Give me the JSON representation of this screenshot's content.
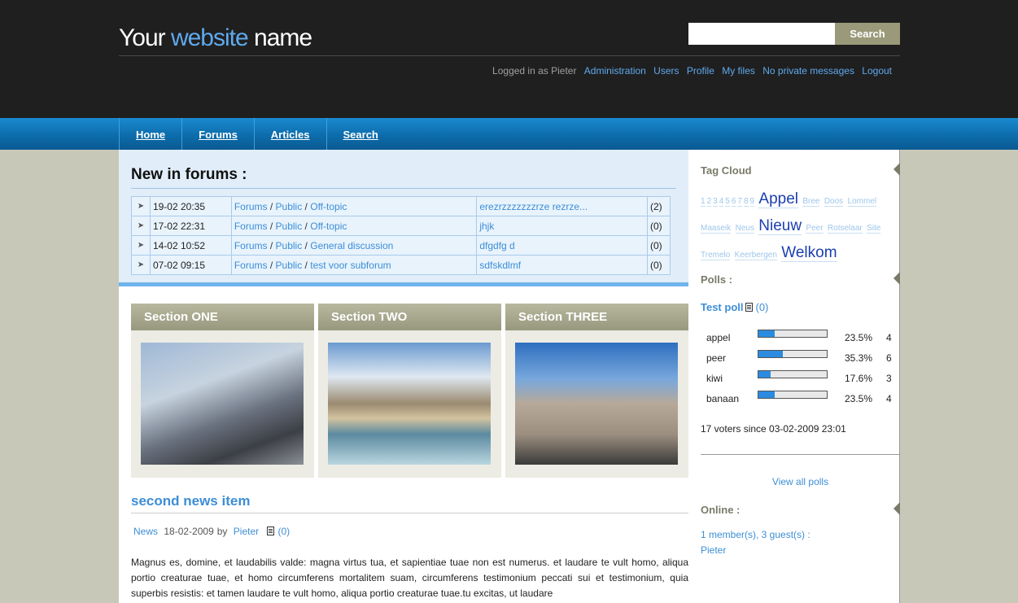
{
  "header": {
    "title_part1": "Your ",
    "title_accent": "website",
    "title_part2": " name",
    "search_value": "",
    "search_button": "Search"
  },
  "userbar": {
    "logged_in_text": "Logged in as Pieter",
    "links": [
      "Administration",
      "Users",
      "Profile",
      "My files",
      "No private messages",
      "Logout"
    ]
  },
  "nav": [
    "Home",
    "Forums",
    "Articles",
    "Search"
  ],
  "forums": {
    "title": "New in forums :",
    "separator": "/",
    "rows": [
      {
        "date": "19-02 20:35",
        "path": [
          "Forums",
          "Public",
          "Off-topic"
        ],
        "topic": "erezrzzzzzzzrze rezrze...",
        "count": "(2)"
      },
      {
        "date": "17-02 22:31",
        "path": [
          "Forums",
          "Public",
          "Off-topic"
        ],
        "topic": "jhjk",
        "count": "(0)"
      },
      {
        "date": "14-02 10:52",
        "path": [
          "Forums",
          "Public",
          "General discussion"
        ],
        "topic": "dfgdfg d",
        "count": "(0)"
      },
      {
        "date": "07-02 09:15",
        "path": [
          "Forums",
          "Public",
          "test voor subforum"
        ],
        "topic": "sdfskdlmf",
        "count": "(0)"
      }
    ]
  },
  "sections": [
    {
      "title": "Section ONE"
    },
    {
      "title": "Section TWO"
    },
    {
      "title": "Section THREE"
    }
  ],
  "news": {
    "title": "second news item",
    "category": "News",
    "date": "18-02-2009",
    "by": "by",
    "author": "Pieter",
    "comments": "(0)",
    "body": "Magnus es, domine, et laudabilis valde: magna virtus tua, et sapientiae tuae non est numerus. et laudare te vult homo, aliqua portio creaturae tuae, et homo circumferens mortalitem suam, circumferens testimonium peccati sui et testimonium, quia superbis resistis: et tamen laudare te vult homo, aliqua portio creaturae tuae.tu excitas, ut laudare"
  },
  "sidebar": {
    "tagcloud_title": "Tag Cloud",
    "tags_line1_small": [
      "1",
      "2",
      "3",
      "4",
      "5",
      "6",
      "7",
      "8",
      "9"
    ],
    "tags": {
      "appel": "Appel",
      "bree": "Bree",
      "doos": "Doos",
      "lommel": "Lommel",
      "maaseik": "Maaseik",
      "neus": "Neus",
      "nieuw": "Nieuw",
      "peer": "Peer",
      "rotselaar": "Rotselaar",
      "site": "Site",
      "tremelo": "Tremelo",
      "keerbergen": "Keerbergen",
      "welkom": "Welkom"
    },
    "polls_title": "Polls :",
    "poll": {
      "title": "Test poll",
      "comments": "(0)",
      "options": [
        {
          "label": "appel",
          "percent_value": 23.5,
          "percent": "23.5%",
          "votes": "4"
        },
        {
          "label": "peer",
          "percent_value": 35.3,
          "percent": "35.3%",
          "votes": "6"
        },
        {
          "label": "kiwi",
          "percent_value": 17.6,
          "percent": "17.6%",
          "votes": "3"
        },
        {
          "label": "banaan",
          "percent_value": 23.5,
          "percent": "23.5%",
          "votes": "4"
        }
      ],
      "voters": "17 voters since 03-02-2009 23:01"
    },
    "view_all_polls": "View all polls",
    "online_title": "Online :",
    "online_count": "1 member(s), 3 guest(s) :",
    "online_member": "Pieter"
  },
  "colors": {
    "accent": "#3d8ed6",
    "header_bg": "#1f1f1f",
    "nav_bg": "#0c6aa8",
    "section_head": "#a8a890",
    "poll_bar": "#2b8be0"
  }
}
